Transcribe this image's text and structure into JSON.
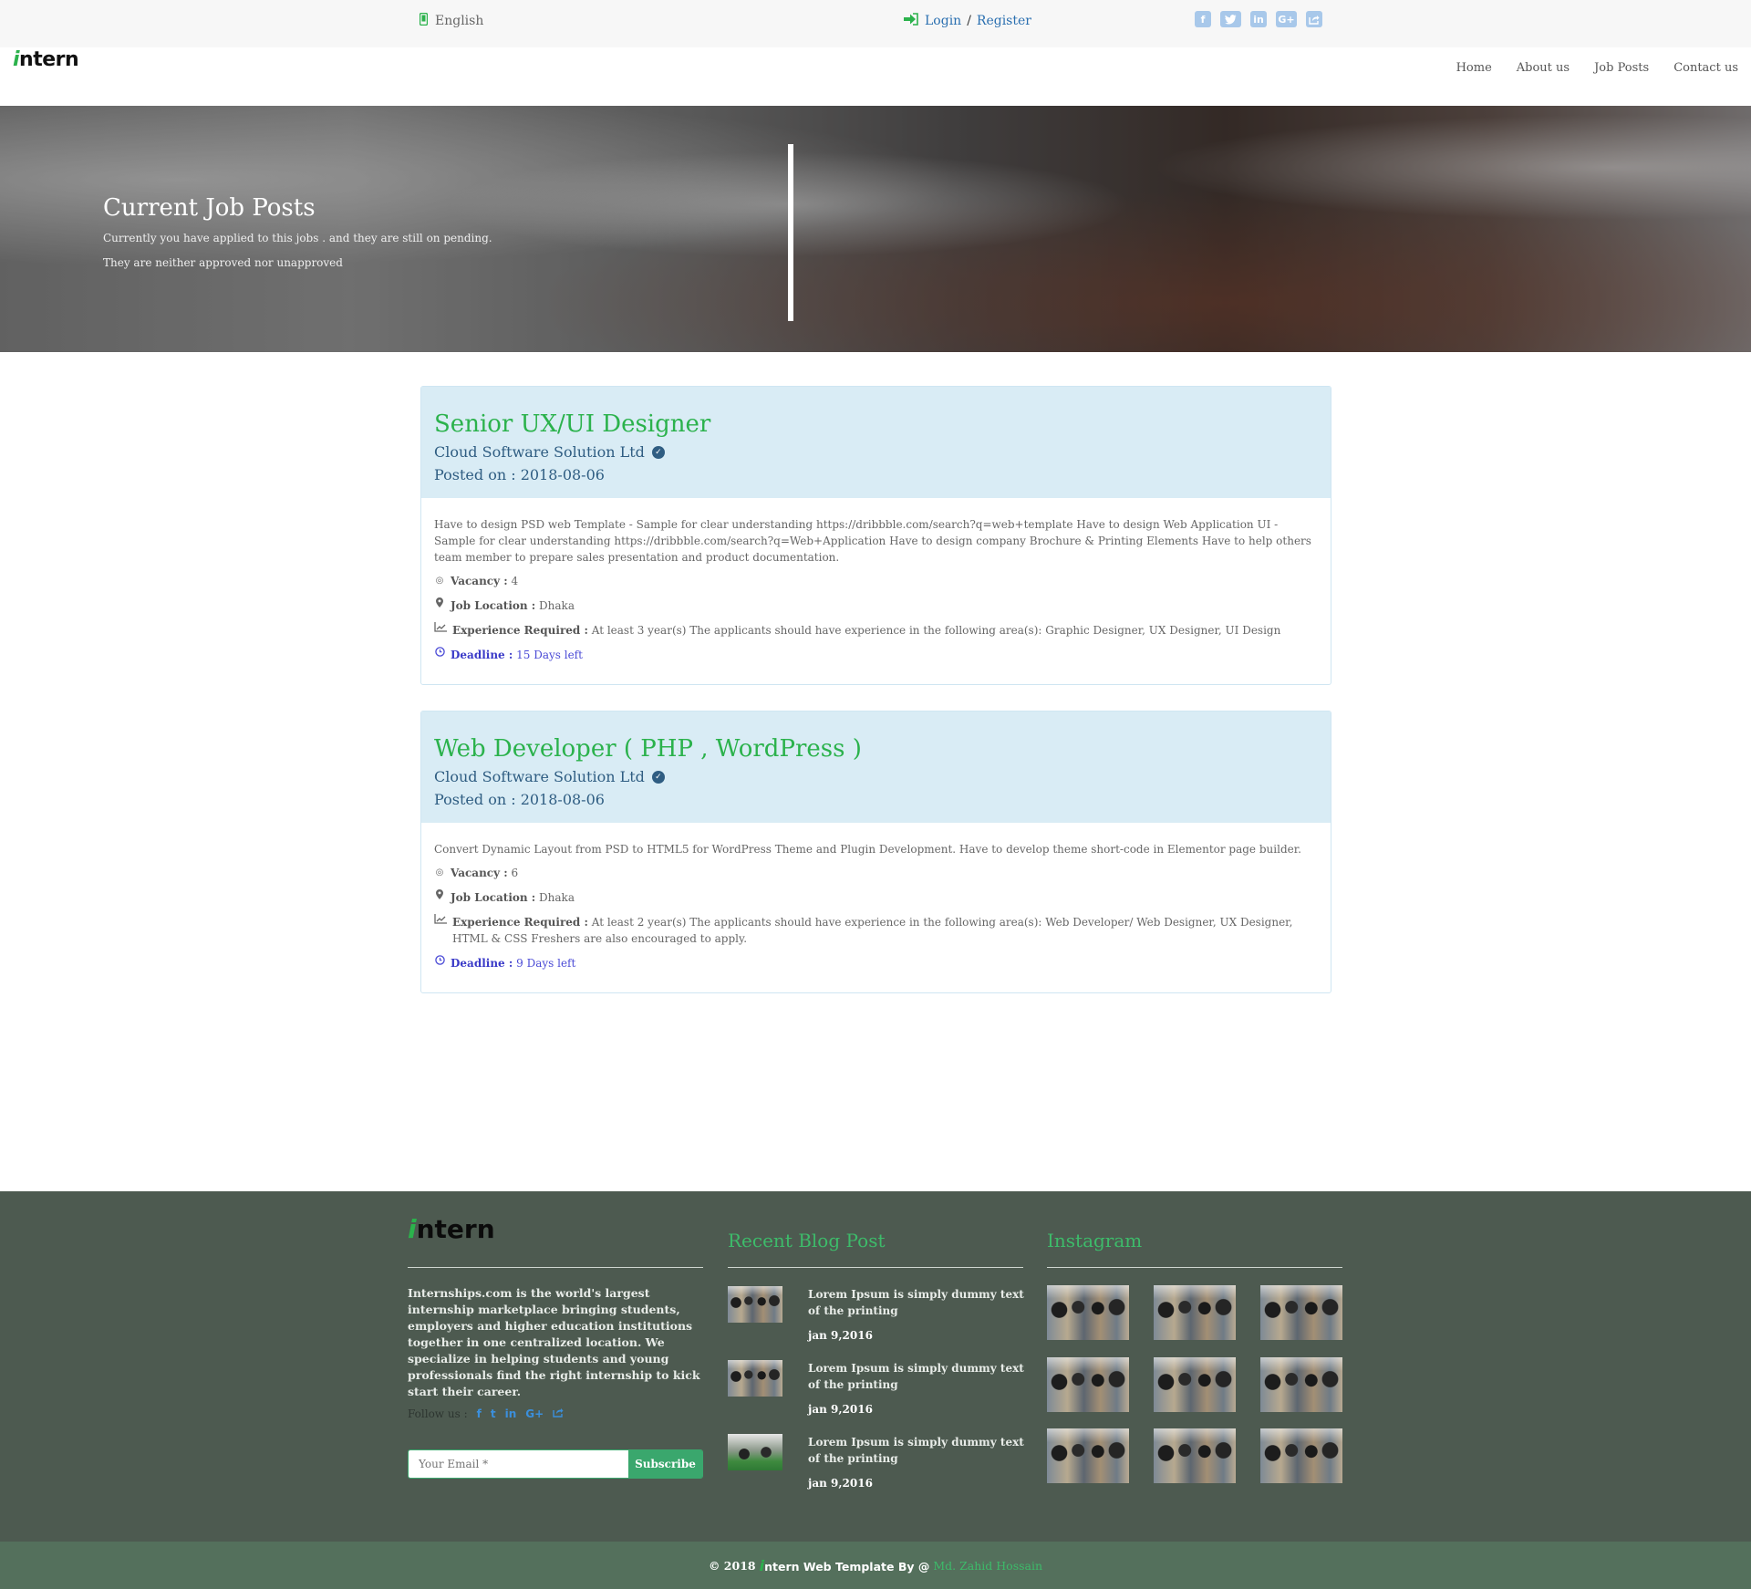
{
  "topbar": {
    "language": "English",
    "login": "Login",
    "separator": "/",
    "register": "Register",
    "social": [
      "f",
      "t",
      "in",
      "G+",
      "share"
    ]
  },
  "header": {
    "logo_i": "i",
    "logo_rest": "ntern",
    "nav": [
      "Home",
      "About us",
      "Job Posts",
      "Contact us"
    ]
  },
  "hero": {
    "title": "Current Job Posts",
    "line1": "Currently you have applied to this jobs . and they are still on pending.",
    "line2": "They are neither approved nor unapproved"
  },
  "jobs": [
    {
      "title": "Senior UX/UI Designer",
      "company": "Cloud Software Solution Ltd",
      "posted": "Posted on : 2018-08-06",
      "description": "Have to design PSD web Template - Sample for clear understanding https://dribbble.com/search?q=web+template Have to design Web Application UI - Sample for clear understanding https://dribbble.com/search?q=Web+Application Have to design company Brochure & Printing Elements Have to help others team member to prepare sales presentation and product documentation.",
      "vacancy_label": "Vacancy :",
      "vacancy": "4",
      "location_label": "Job Location :",
      "location": "Dhaka",
      "experience_label": "Experience Required :",
      "experience": "At least 3 year(s) The applicants should have experience in the following area(s): Graphic Designer, UX Designer, UI Design",
      "deadline_label": "Deadline :",
      "deadline": "15 Days left"
    },
    {
      "title": "Web Developer ( PHP , WordPress )",
      "company": "Cloud Software Solution Ltd",
      "posted": "Posted on : 2018-08-06",
      "description": "Convert Dynamic Layout from PSD to HTML5 for WordPress Theme and Plugin Development. Have to develop theme short-code in Elementor page builder.",
      "vacancy_label": "Vacancy :",
      "vacancy": "6",
      "location_label": "Job Location :",
      "location": "Dhaka",
      "experience_label": "Experience Required :",
      "experience": "At least 2 year(s) The applicants should have experience in the following area(s): Web Developer/ Web Designer, UX Designer, HTML & CSS Freshers are also encouraged to apply.",
      "deadline_label": "Deadline :",
      "deadline": "9 Days left"
    }
  ],
  "footer": {
    "about": "Internships.com is the world's largest internship marketplace bringing students, employers and higher education institutions together in one centralized location. We specialize in helping students and young professionals find the right internship to kick start their career.",
    "follow_label": "Follow us :",
    "follow_icons": [
      "f",
      "t",
      "in",
      "G+",
      "share"
    ],
    "email_placeholder": "Your Email *",
    "subscribe": "Subscribe",
    "blog_title": "Recent Blog Post",
    "posts": [
      {
        "title": "Lorem Ipsum is simply dummy text of the printing",
        "date": "jan 9,2016"
      },
      {
        "title": "Lorem Ipsum is simply dummy text of the printing",
        "date": "jan 9,2016"
      },
      {
        "title": "Lorem Ipsum is simply dummy text of the printing",
        "date": "jan 9,2016"
      }
    ],
    "instagram_title": "Instagram"
  },
  "copyright": {
    "prefix": "© 2018",
    "logo_i": "i",
    "logo_rest": "ntern Web Template By @",
    "author": "Md. Zahid Hossain"
  },
  "colors": {
    "brand_green": "#2bb24c",
    "link_blue": "#2a6fb0",
    "card_head": "#d9ecf5",
    "footer_bg": "#4d5a50",
    "copyright_bg": "#54705c",
    "deadline": "#4a4ad6"
  }
}
